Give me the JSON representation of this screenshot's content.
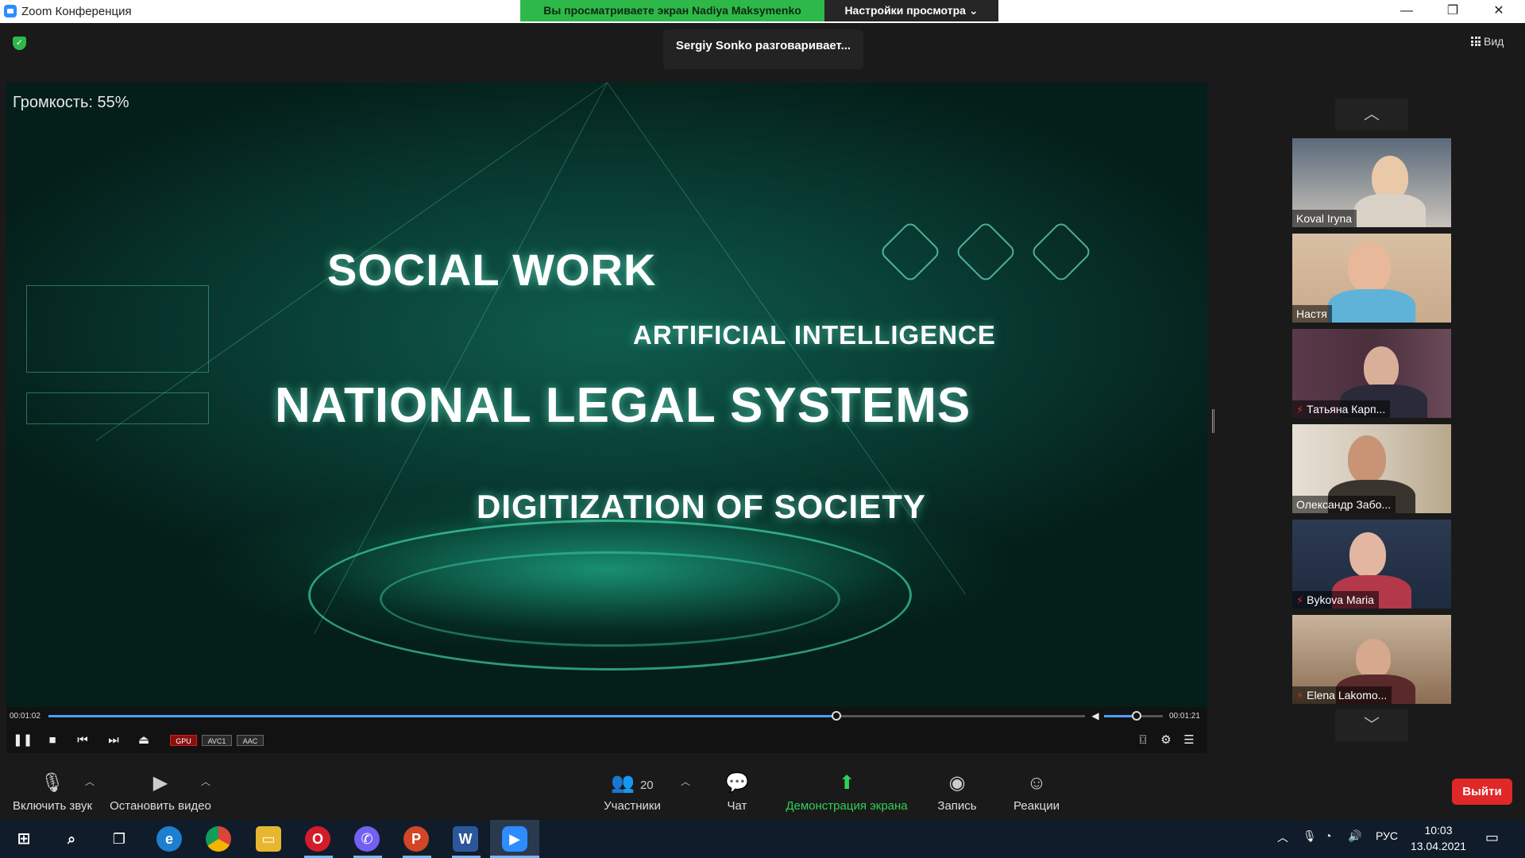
{
  "window": {
    "title": "Zoom Конференция",
    "share_banner": "Вы просматриваете экран Nadiya Maksymenko",
    "view_settings": "Настройки просмотра",
    "controls": {
      "minimize": "—",
      "restore": "❐",
      "close": "✕"
    }
  },
  "top": {
    "talking": "Sergiy Sonko разговаривает...",
    "view_label": "Вид"
  },
  "video": {
    "volume_label": "Громкость: 55%",
    "slide": {
      "line1": "SOCIAL WORK",
      "line2": "ARTIFICIAL INTELLIGENCE",
      "line3": "NATIONAL LEGAL SYSTEMS",
      "line4": "DIGITIZATION OF SOCIETY"
    },
    "accent_color": "#29e6b4"
  },
  "player": {
    "time_elapsed": "00:01:02",
    "time_total": "00:01:21",
    "progress": 0.76,
    "volume": 0.55,
    "tags": [
      "GPU",
      "AVC1",
      "AAC"
    ]
  },
  "participants": [
    {
      "name": "Koval  Iryna",
      "muted": false
    },
    {
      "name": "Настя",
      "muted": false
    },
    {
      "name": "Татьяна Карп...",
      "muted": true
    },
    {
      "name": "Олександр Забо...",
      "muted": false
    },
    {
      "name": "Bykova Maria",
      "muted": true
    },
    {
      "name": "Elena Lakomo...",
      "muted": true
    }
  ],
  "toolbar": {
    "unmute": "Включить звук",
    "stop_video": "Остановить видео",
    "participants": "Участники",
    "participants_count": "20",
    "chat": "Чат",
    "share_screen": "Демонстрация экрана",
    "record": "Запись",
    "reactions": "Реакции",
    "leave": "Выйти",
    "share_color": "#2fd057",
    "leave_color": "#e02828"
  },
  "taskbar": {
    "language": "РУС",
    "time": "10:03",
    "date": "13.04.2021"
  }
}
